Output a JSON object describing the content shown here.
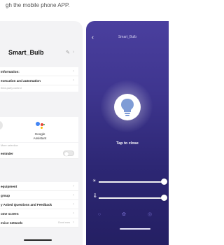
{
  "caption": "gh the mobile phone APP.",
  "left_phone": {
    "device_name": "Smart_Bulb",
    "edit_icon": "pencil-icon",
    "rows": {
      "information": "Information:",
      "execution": "execution and automation",
      "third_party_sub": "third-party control",
      "assistant_label": "Google Assistant",
      "more_sub": "More selection",
      "reminder": "eminder",
      "equipment": "equipment",
      "group": "group",
      "faq": "y Asked Questions and Feedback",
      "home_screen": "ome screen",
      "device_network": "evice network:",
      "network_value": "Good now"
    }
  },
  "right_phone": {
    "title": "Smart_Bulb",
    "back_icon": "chevron-left-icon",
    "tap_label": "Tap to close",
    "brightness_icon": "sun-icon",
    "temperature_icon": "thermometer-icon",
    "brightness_level": 1.0,
    "temperature_level": 1.0,
    "tabs": [
      "power-tab-icon",
      "palette-tab-icon",
      "timer-tab-icon"
    ]
  },
  "colors": {
    "accent_purple": "#4a3f9e",
    "google_blue": "#4285f4",
    "google_red": "#ea4335",
    "google_yellow": "#fbbc05",
    "google_green": "#34a853"
  }
}
